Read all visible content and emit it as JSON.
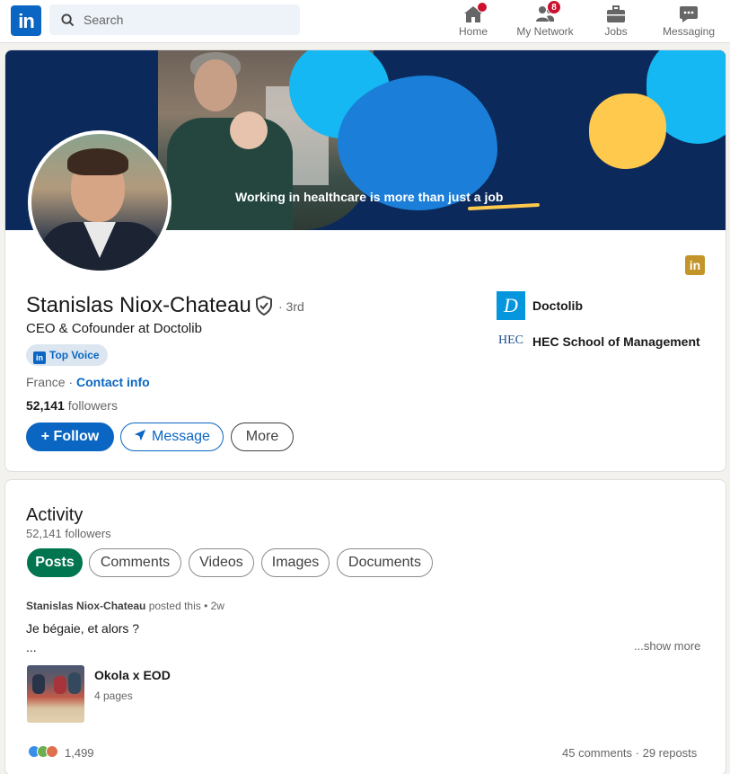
{
  "nav": {
    "logo_text": "in",
    "search_placeholder": "Search",
    "items": [
      {
        "label": "Home",
        "icon": "home-icon",
        "badge": ""
      },
      {
        "label": "My Network",
        "icon": "network-icon",
        "badge": "8"
      },
      {
        "label": "Jobs",
        "icon": "briefcase-icon",
        "badge": ""
      },
      {
        "label": "Messaging",
        "icon": "chat-icon",
        "badge": ""
      }
    ]
  },
  "profile": {
    "banner_text_a": "Working in healthcare is more than ",
    "banner_text_b": "just a job",
    "name": "Stanislas Niox-Chateau",
    "degree": "· 3rd",
    "headline": "CEO & Cofounder at Doctolib",
    "badge_label": "Top Voice",
    "badge_icon_text": "in",
    "location": "France · ",
    "contact_info": "Contact info",
    "followers_count": "52,141",
    "followers_label": " followers",
    "corner_logo_text": "in",
    "buttons": {
      "follow": "+ Follow",
      "message": "Message",
      "more": "More"
    },
    "companies": [
      {
        "name": "Doctolib",
        "logo_text": "D"
      },
      {
        "name": "HEC School of Management",
        "logo_text": "HEC"
      }
    ]
  },
  "activity": {
    "title": "Activity",
    "followers": "52,141 followers",
    "tabs": [
      "Posts",
      "Comments",
      "Videos",
      "Images",
      "Documents"
    ],
    "active_tab": "Posts",
    "post": {
      "author": "Stanislas Niox-Chateau",
      "meta": " posted this • 2w",
      "text": "Je bégaie, et alors ?",
      "ellipsis": "...",
      "show_more": "...show more",
      "doc_title": "Okola x EOD",
      "doc_pages": "4 pages",
      "reaction_count": "1,499",
      "engagement": "45 comments · 29 reposts"
    }
  },
  "colors": {
    "brand": "#0a66c2",
    "active_tab": "#01754f",
    "badge": "#cb112d"
  }
}
